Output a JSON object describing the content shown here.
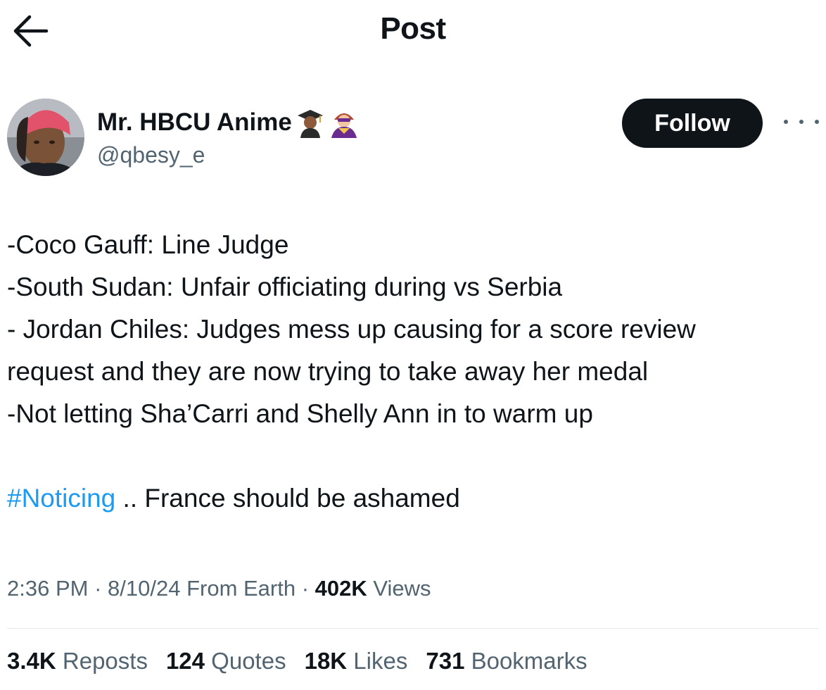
{
  "header": {
    "title": "Post",
    "back_icon": "arrow-left-icon"
  },
  "author": {
    "display_name": "Mr. HBCU Anime",
    "emojis": [
      "graduate-emoji",
      "supervillain-emoji"
    ],
    "handle": "@qbesy_e",
    "follow_label": "Follow",
    "more_icon": "more-icon"
  },
  "tweet": {
    "lines": [
      "-Coco Gauff: Line Judge",
      "-South Sudan: Unfair officiating during vs Serbia",
      "- Jordan Chiles: Judges mess up causing for a score review",
      "request and they are now trying to take away her medal",
      "-Not letting Sha’Carri and Shelly Ann in to warm up"
    ],
    "hashtag": "#Noticing",
    "after_hashtag": " .. France should be ashamed"
  },
  "meta": {
    "time": "2:36 PM",
    "sep1": " · ",
    "date": "8/10/24",
    "source": " From Earth",
    "sep2": " · ",
    "views_count": "402K",
    "views_label": " Views"
  },
  "stats": {
    "reposts_count": "3.4K",
    "reposts_label": " Reposts",
    "quotes_count": "124",
    "quotes_label": " Quotes",
    "likes_count": "18K",
    "likes_label": " Likes",
    "bookmarks_count": "731",
    "bookmarks_label": " Bookmarks"
  },
  "colors": {
    "accent": "#1d9bf0",
    "text": "#0f1419",
    "secondary": "#536471",
    "button_bg": "#0f1419"
  }
}
